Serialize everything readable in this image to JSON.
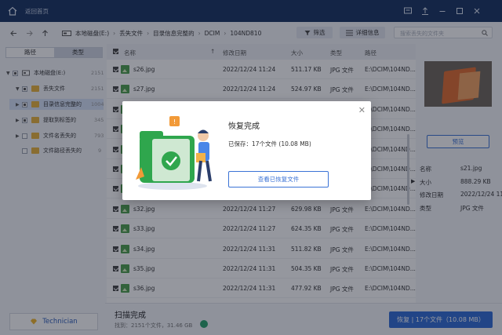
{
  "titlebar": {
    "back_label": "返回首页"
  },
  "breadcrumb": [
    "本地磁盘(E:)",
    "丢失文件",
    "目录信息完整的",
    "DCIM",
    "104ND810"
  ],
  "toolbar": {
    "filter_label": "筛选",
    "details_label": "详细信息",
    "search_placeholder": "搜索丢失的文件夹"
  },
  "sidebar": {
    "tab_path": "路径",
    "tab_type": "类型",
    "tree": [
      {
        "label": "本地磁盘(E:)",
        "count": "2151"
      },
      {
        "label": "丢失文件",
        "count": "2151"
      },
      {
        "label": "目录信息完整的",
        "count": "1004"
      },
      {
        "label": "提取到标签的",
        "count": "345"
      },
      {
        "label": "文件名丢失的",
        "count": "793"
      },
      {
        "label": "文件路径丢失的",
        "count": "9"
      }
    ],
    "technician_label": "Technician"
  },
  "table": {
    "columns": {
      "name": "名称",
      "date": "修改日期",
      "size": "大小",
      "type": "类型",
      "path": "路径"
    },
    "rows": [
      {
        "name": "s26.jpg",
        "date": "2022/12/24 11:24",
        "size": "511.17 KB",
        "type": "JPG 文件",
        "path": "E:\\DCIM\\104ND..."
      },
      {
        "name": "s27.jpg",
        "date": "2022/12/24 11:24",
        "size": "524.97 KB",
        "type": "JPG 文件",
        "path": "E:\\DCIM\\104ND..."
      },
      {
        "name": "",
        "date": "",
        "size": "",
        "type": "",
        "path": "E:\\DCIM\\104ND..."
      },
      {
        "name": "",
        "date": "",
        "size": "",
        "type": "",
        "path": "E:\\DCIM\\104ND..."
      },
      {
        "name": "",
        "date": "",
        "size": "",
        "type": "",
        "path": "E:\\DCIM\\104ND..."
      },
      {
        "name": "",
        "date": "",
        "size": "",
        "type": "",
        "path": "E:\\DCIM\\104ND..."
      },
      {
        "name": "",
        "date": "",
        "size": "",
        "type": "",
        "path": "E:\\DCIM\\104ND..."
      },
      {
        "name": "s32.jpg",
        "date": "2022/12/24 11:27",
        "size": "629.98 KB",
        "type": "JPG 文件",
        "path": "E:\\DCIM\\104ND..."
      },
      {
        "name": "s33.jpg",
        "date": "2022/12/24 11:27",
        "size": "624.35 KB",
        "type": "JPG 文件",
        "path": "E:\\DCIM\\104ND..."
      },
      {
        "name": "s34.jpg",
        "date": "2022/12/24 11:31",
        "size": "511.82 KB",
        "type": "JPG 文件",
        "path": "E:\\DCIM\\104ND..."
      },
      {
        "name": "s35.jpg",
        "date": "2022/12/24 11:31",
        "size": "504.35 KB",
        "type": "JPG 文件",
        "path": "E:\\DCIM\\104ND..."
      },
      {
        "name": "s36.jpg",
        "date": "2022/12/24 11:31",
        "size": "477.92 KB",
        "type": "JPG 文件",
        "path": "E:\\DCIM\\104ND..."
      }
    ]
  },
  "preview": {
    "button_label": "预览",
    "props": [
      {
        "key": "名称",
        "value": "s21.jpg"
      },
      {
        "key": "大小",
        "value": "888.29 KB"
      },
      {
        "key": "修改日期",
        "value": "2022/12/24 11:"
      },
      {
        "key": "类型",
        "value": "JPG 文件"
      }
    ]
  },
  "status": {
    "title": "扫描完成",
    "found": "找到：2151个文件，31.46 GB",
    "recover_label": "恢复 | 17个文件（10.08 MB）"
  },
  "dialog": {
    "title": "恢复完成",
    "saved": "已保存：17个文件 (10.08 MB)",
    "view_button": "查看已恢复文件"
  },
  "colors": {
    "titlebar": "#15305f",
    "accent": "#2f6bd6",
    "success": "#27a06b"
  }
}
